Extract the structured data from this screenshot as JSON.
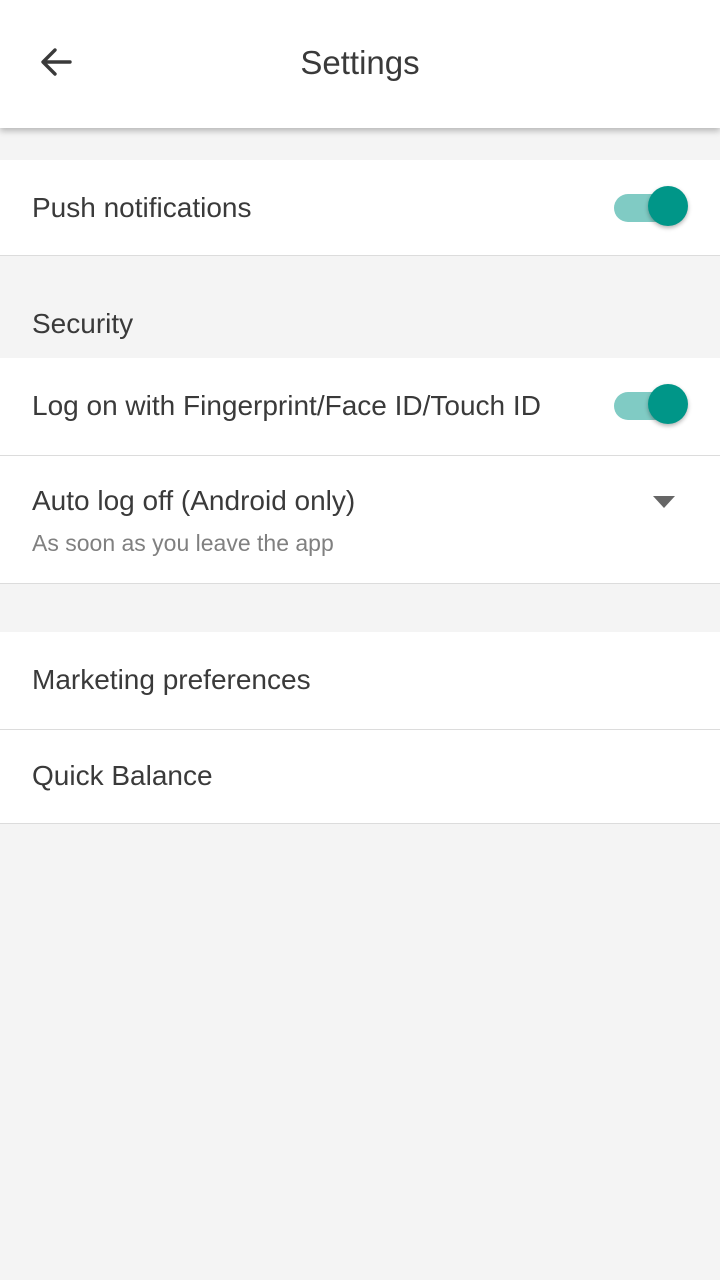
{
  "header": {
    "back_icon": "arrow-left-icon",
    "title": "Settings"
  },
  "push_notifications": {
    "label": "Push notifications",
    "enabled": true
  },
  "security": {
    "header": "Security",
    "biometric": {
      "label": "Log on with Fingerprint/Face ID/Touch ID",
      "enabled": true
    },
    "auto_log_off": {
      "label": "Auto log off (Android only)",
      "value": "As soon as you leave the app",
      "icon": "caret-down-icon"
    }
  },
  "other": {
    "marketing_label": "Marketing preferences",
    "quick_balance_label": "Quick Balance"
  },
  "colors": {
    "accent": "#009688",
    "accent_track": "#80cbc4",
    "background": "#f4f4f4"
  }
}
